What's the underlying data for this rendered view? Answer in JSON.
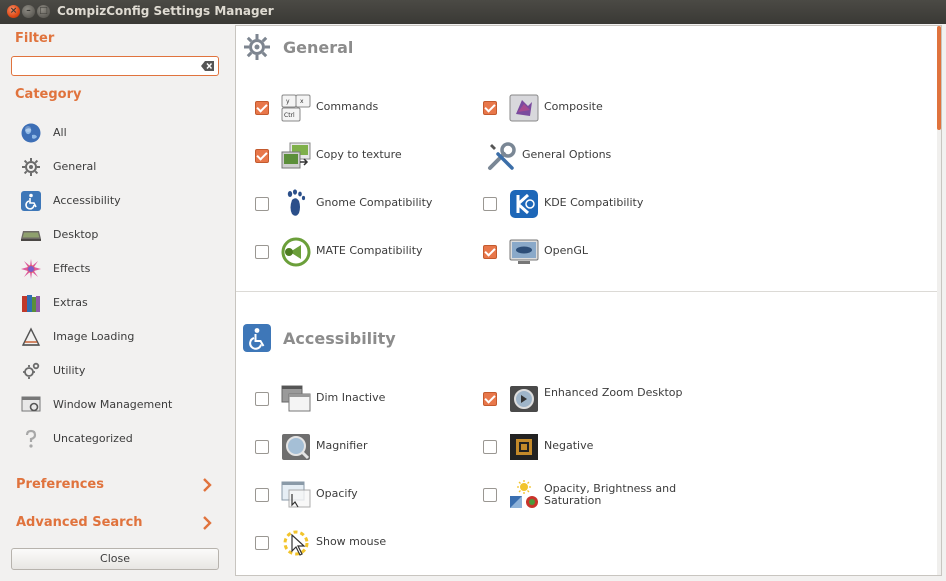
{
  "window": {
    "title": "CompizConfig Settings Manager"
  },
  "sidebar": {
    "filter_label": "Filter",
    "filter_value": "",
    "category_label": "Category",
    "categories": [
      {
        "label": "All",
        "icon": "globe-icon"
      },
      {
        "label": "General",
        "icon": "gear-icon"
      },
      {
        "label": "Accessibility",
        "icon": "accessibility-icon"
      },
      {
        "label": "Desktop",
        "icon": "desktop-icon"
      },
      {
        "label": "Effects",
        "icon": "effects-icon"
      },
      {
        "label": "Extras",
        "icon": "extras-icon"
      },
      {
        "label": "Image Loading",
        "icon": "image-loading-icon"
      },
      {
        "label": "Utility",
        "icon": "utility-icon"
      },
      {
        "label": "Window Management",
        "icon": "window-management-icon"
      },
      {
        "label": "Uncategorized",
        "icon": "question-icon"
      }
    ],
    "preferences_label": "Preferences",
    "advanced_search_label": "Advanced Search",
    "close_label": "Close"
  },
  "main": {
    "sections": [
      {
        "title": "General",
        "icon": "gear-icon",
        "plugins": [
          {
            "label": "Commands",
            "checked": true,
            "icon": "commands-icon"
          },
          {
            "label": "Composite",
            "checked": true,
            "icon": "composite-icon"
          },
          {
            "label": "Copy to texture",
            "checked": true,
            "icon": "copy-to-texture-icon"
          },
          {
            "label": "General Options",
            "checked": null,
            "icon": "wrench-screwdriver-icon"
          },
          {
            "label": "Gnome Compatibility",
            "checked": false,
            "icon": "gnome-foot-icon"
          },
          {
            "label": "KDE Compatibility",
            "checked": false,
            "icon": "kde-icon"
          },
          {
            "label": "MATE Compatibility",
            "checked": false,
            "icon": "mate-icon"
          },
          {
            "label": "OpenGL",
            "checked": true,
            "icon": "opengl-monitor-icon"
          }
        ]
      },
      {
        "title": "Accessibility",
        "icon": "accessibility-icon",
        "plugins": [
          {
            "label": "Dim Inactive",
            "checked": false,
            "icon": "dim-inactive-icon"
          },
          {
            "label": "Enhanced Zoom Desktop",
            "checked": true,
            "icon": "enhanced-zoom-icon"
          },
          {
            "label": "Magnifier",
            "checked": false,
            "icon": "magnifier-icon"
          },
          {
            "label": "Negative",
            "checked": false,
            "icon": "negative-icon"
          },
          {
            "label": "Opacify",
            "checked": false,
            "icon": "opacify-icon"
          },
          {
            "label": "Opacity, Brightness and Saturation",
            "checked": false,
            "icon": "obs-icon"
          },
          {
            "label": "Show mouse",
            "checked": false,
            "icon": "show-mouse-icon"
          }
        ]
      }
    ]
  },
  "colors": {
    "accent": "#e0733d",
    "checkbox_on": "#e8774a"
  }
}
